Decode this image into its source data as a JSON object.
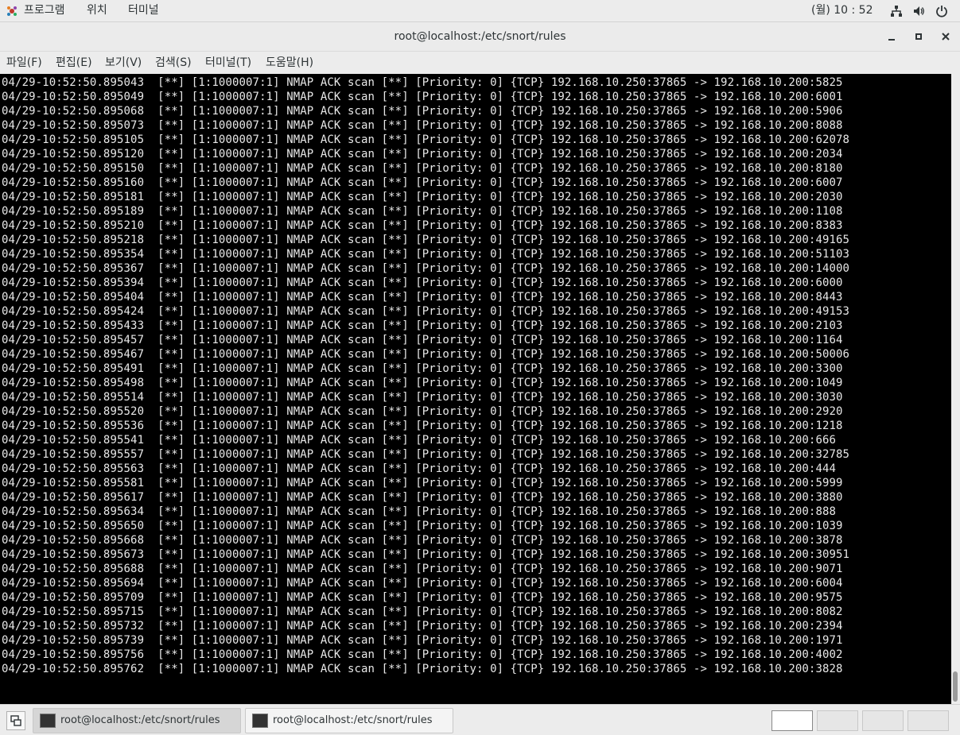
{
  "topbar": {
    "programs": "프로그램",
    "places": "위치",
    "terminal": "터미널",
    "clock": "(월) 10 : 52"
  },
  "window": {
    "title": "root@localhost:/etc/snort/rules"
  },
  "menubar": {
    "items": [
      "파일(F)",
      "편집(E)",
      "보기(V)",
      "검색(S)",
      "터미널(T)",
      "도움말(H)"
    ]
  },
  "log": {
    "prefix_date": "04/29-10:52:50.",
    "rule": "[**] [1:1000007:1] NMAP ACK scan [**] [Priority: 0] {TCP} 192.168.10.250:37865 -> 192.168.10.200:",
    "entries": [
      [
        "895043",
        "5825"
      ],
      [
        "895049",
        "6001"
      ],
      [
        "895068",
        "5906"
      ],
      [
        "895073",
        "8088"
      ],
      [
        "895105",
        "62078"
      ],
      [
        "895120",
        "2034"
      ],
      [
        "895150",
        "8180"
      ],
      [
        "895160",
        "6007"
      ],
      [
        "895181",
        "2030"
      ],
      [
        "895189",
        "1108"
      ],
      [
        "895210",
        "8383"
      ],
      [
        "895218",
        "49165"
      ],
      [
        "895354",
        "51103"
      ],
      [
        "895367",
        "14000"
      ],
      [
        "895394",
        "6000"
      ],
      [
        "895404",
        "8443"
      ],
      [
        "895424",
        "49153"
      ],
      [
        "895433",
        "2103"
      ],
      [
        "895457",
        "1164"
      ],
      [
        "895467",
        "50006"
      ],
      [
        "895491",
        "3300"
      ],
      [
        "895498",
        "1049"
      ],
      [
        "895514",
        "3030"
      ],
      [
        "895520",
        "2920"
      ],
      [
        "895536",
        "1218"
      ],
      [
        "895541",
        "666"
      ],
      [
        "895557",
        "32785"
      ],
      [
        "895563",
        "444"
      ],
      [
        "895581",
        "5999"
      ],
      [
        "895617",
        "3880"
      ],
      [
        "895634",
        "888"
      ],
      [
        "895650",
        "1039"
      ],
      [
        "895668",
        "3878"
      ],
      [
        "895673",
        "30951"
      ],
      [
        "895688",
        "9071"
      ],
      [
        "895694",
        "6004"
      ],
      [
        "895709",
        "9575"
      ],
      [
        "895715",
        "8082"
      ],
      [
        "895732",
        "2394"
      ],
      [
        "895739",
        "1971"
      ],
      [
        "895756",
        "4002"
      ],
      [
        "895762",
        "3828"
      ]
    ]
  },
  "taskbar": {
    "tasks": [
      "root@localhost:/etc/snort/rules",
      "root@localhost:/etc/snort/rules"
    ]
  },
  "icons": {
    "apps": "apps-icon",
    "network": "network-icon",
    "volume": "volume-icon",
    "power": "power-icon"
  }
}
